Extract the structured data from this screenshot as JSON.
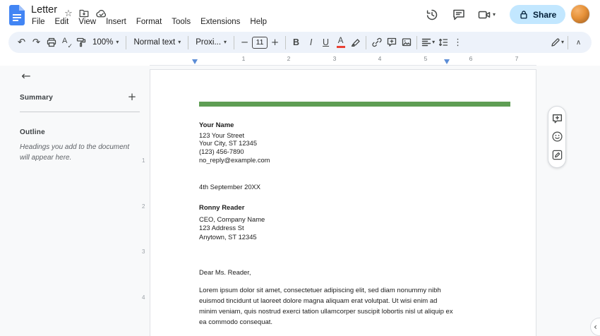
{
  "header": {
    "title": "Letter",
    "menus": [
      "File",
      "Edit",
      "View",
      "Insert",
      "Format",
      "Tools",
      "Extensions",
      "Help"
    ],
    "share_label": "Share"
  },
  "toolbar": {
    "zoom_value": "100%",
    "style_value": "Normal text",
    "font_value": "Proxi...",
    "font_size_value": "11"
  },
  "icons": {
    "star": "☆",
    "caret_down": "▾",
    "undo": "↶",
    "redo": "↷",
    "spell_a": "A",
    "check": "✓",
    "minus": "−",
    "plus": "+",
    "bold": "B",
    "italic": "I",
    "underline": "U",
    "text_color": "A",
    "more_vertical": "⋮",
    "collapse": "∧",
    "back_arrow": "←",
    "add": "+",
    "chevron_left": "‹"
  },
  "ruler": {
    "marks": [
      "1",
      "2",
      "3",
      "4",
      "5",
      "6",
      "7"
    ]
  },
  "vruler": {
    "marks": [
      "1",
      "2",
      "3",
      "4"
    ]
  },
  "sidebar": {
    "summary_label": "Summary",
    "outline_label": "Outline",
    "outline_hint": "Headings you add to the document will appear here."
  },
  "document": {
    "accent_color": "#5f9e54",
    "sender": {
      "name": "Your Name",
      "lines": [
        "123 Your Street",
        "Your City, ST 12345",
        "(123) 456-7890",
        "no_reply@example.com"
      ]
    },
    "date": "4th September 20XX",
    "recipient": {
      "name": "Ronny Reader",
      "lines": [
        "CEO, Company Name",
        "123 Address St",
        "Anytown, ST 12345"
      ]
    },
    "greeting": "Dear Ms. Reader,",
    "body": "Lorem ipsum dolor sit amet, consectetuer adipiscing elit, sed diam nonummy nibh euismod tincidunt ut laoreet dolore magna aliquam erat volutpat. Ut wisi enim ad minim veniam, quis nostrud exerci tation ullamcorper suscipit lobortis nisl ut aliquip ex ea commodo consequat."
  }
}
